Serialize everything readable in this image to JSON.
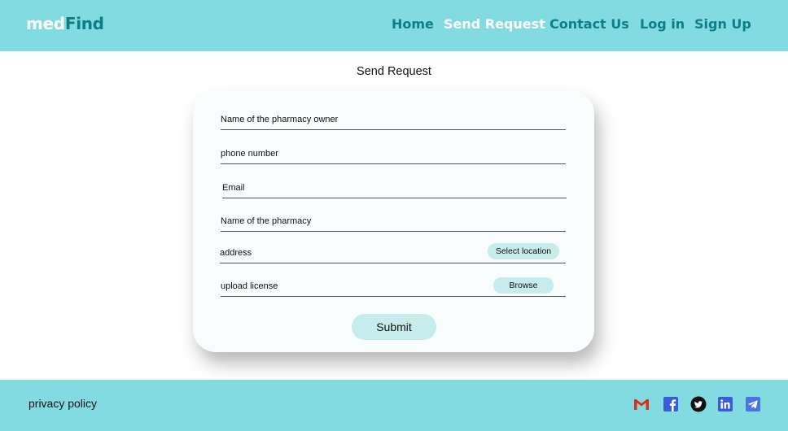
{
  "header": {
    "logo_part1": "med",
    "logo_part2": "Find",
    "nav": [
      "Home",
      "Send Request",
      "Contact Us",
      "Log in",
      "Sign Up"
    ],
    "active_nav": "Send Request"
  },
  "main": {
    "title": "Send Request",
    "form": {
      "owner_name_label": "Name of the pharmacy owner",
      "phone_label": "phone number",
      "email_label": "Email",
      "pharmacy_name_label": "Name of the pharmacy",
      "address_label": "address",
      "select_location_label": "Select location",
      "license_label": "upload license",
      "browse_label": "Browse",
      "submit_label": "Submit"
    }
  },
  "footer": {
    "privacy_label": "privacy policy",
    "social_icons": [
      "gmail-icon",
      "facebook-icon",
      "twitter-icon",
      "linkedin-icon",
      "telegram-icon"
    ]
  },
  "colors": {
    "header_bg": "#82dbe1",
    "accent_teal": "#0d7e86",
    "pill_bg": "#c6ecee",
    "card_bg": "#f8fcfd"
  }
}
